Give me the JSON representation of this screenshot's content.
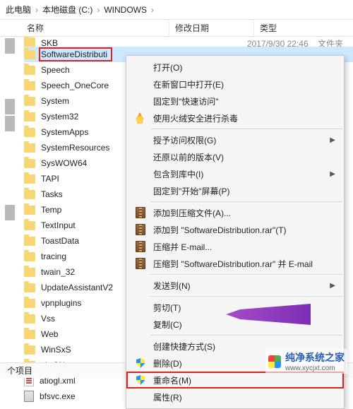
{
  "breadcrumb": {
    "segs": [
      "此电脑",
      "本地磁盘 (C:)",
      "WINDOWS"
    ]
  },
  "columns": {
    "name": "名称",
    "date": "修改日期",
    "type": "类型"
  },
  "top_row": {
    "name": "SKB",
    "date": "2017/9/30 22:46",
    "type": "文件夹"
  },
  "files": {
    "f0": {
      "name": "SoftwareDistributi"
    },
    "f1": {
      "name": "Speech"
    },
    "f2": {
      "name": "Speech_OneCore"
    },
    "f3": {
      "name": "System"
    },
    "f4": {
      "name": "System32"
    },
    "f5": {
      "name": "SystemApps"
    },
    "f6": {
      "name": "SystemResources"
    },
    "f7": {
      "name": "SysWOW64"
    },
    "f8": {
      "name": "TAPI"
    },
    "f9": {
      "name": "Tasks"
    },
    "f10": {
      "name": "Temp"
    },
    "f11": {
      "name": "TextInput"
    },
    "f12": {
      "name": "ToastData"
    },
    "f13": {
      "name": "tracing"
    },
    "f14": {
      "name": "twain_32"
    },
    "f15": {
      "name": "UpdateAssistantV2"
    },
    "f16": {
      "name": "vpnplugins"
    },
    "f17": {
      "name": "Vss"
    },
    "f18": {
      "name": "Web"
    },
    "f19": {
      "name": "WinSxS"
    },
    "f20": {
      "name": "zh-CN"
    },
    "f21": {
      "name": "atiogl.xml"
    },
    "f22": {
      "name": "bfsvc.exe"
    }
  },
  "menu": {
    "open": "打开(O)",
    "newwin": "在新窗口中打开(E)",
    "pin_quick": "固定到\"快速访问\"",
    "huorong": "使用火绒安全进行杀毒",
    "grant": "授予访问权限(G)",
    "restore": "还原以前的版本(V)",
    "include_lib": "包含到库中(I)",
    "pin_start": "固定到\"开始\"屏幕(P)",
    "add_archive": "添加到压缩文件(A)...",
    "add_rar": "添加到 \"SoftwareDistribution.rar\"(T)",
    "compress_email": "压缩并 E-mail...",
    "compress_rar_email": "压缩到 \"SoftwareDistribution.rar\" 并 E-mail",
    "sendto": "发送到(N)",
    "cut": "剪切(T)",
    "copy": "复制(C)",
    "shortcut": "创建快捷方式(S)",
    "delete": "删除(D)",
    "rename": "重命名(M)",
    "properties": "属性(R)"
  },
  "status": {
    "text": "个项目"
  },
  "watermark": {
    "title": "纯净系统之家",
    "url": "www.xycjxt.com"
  }
}
